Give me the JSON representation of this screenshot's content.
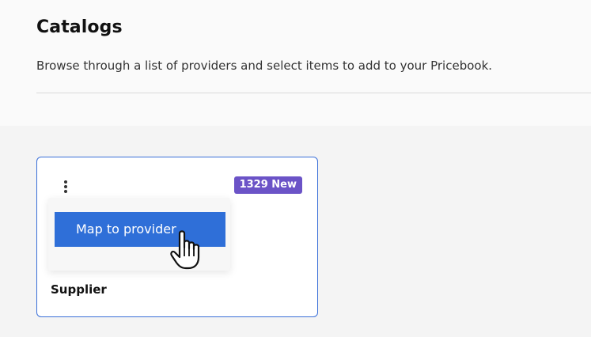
{
  "page": {
    "title": "Catalogs",
    "subtitle": "Browse through a list of providers and select items to add to your Pricebook."
  },
  "card": {
    "badge": "1329 New",
    "title": "Supplier",
    "menu": {
      "items": [
        {
          "label": "Map to provider"
        }
      ]
    }
  },
  "colors": {
    "accent": "#2f6fd8",
    "badge": "#6b53c7",
    "card_border": "#3a6fd8",
    "background": "#f4f4f4"
  },
  "icons": {
    "kebab": "more-vertical-icon",
    "cursor": "hand-pointer-icon"
  }
}
